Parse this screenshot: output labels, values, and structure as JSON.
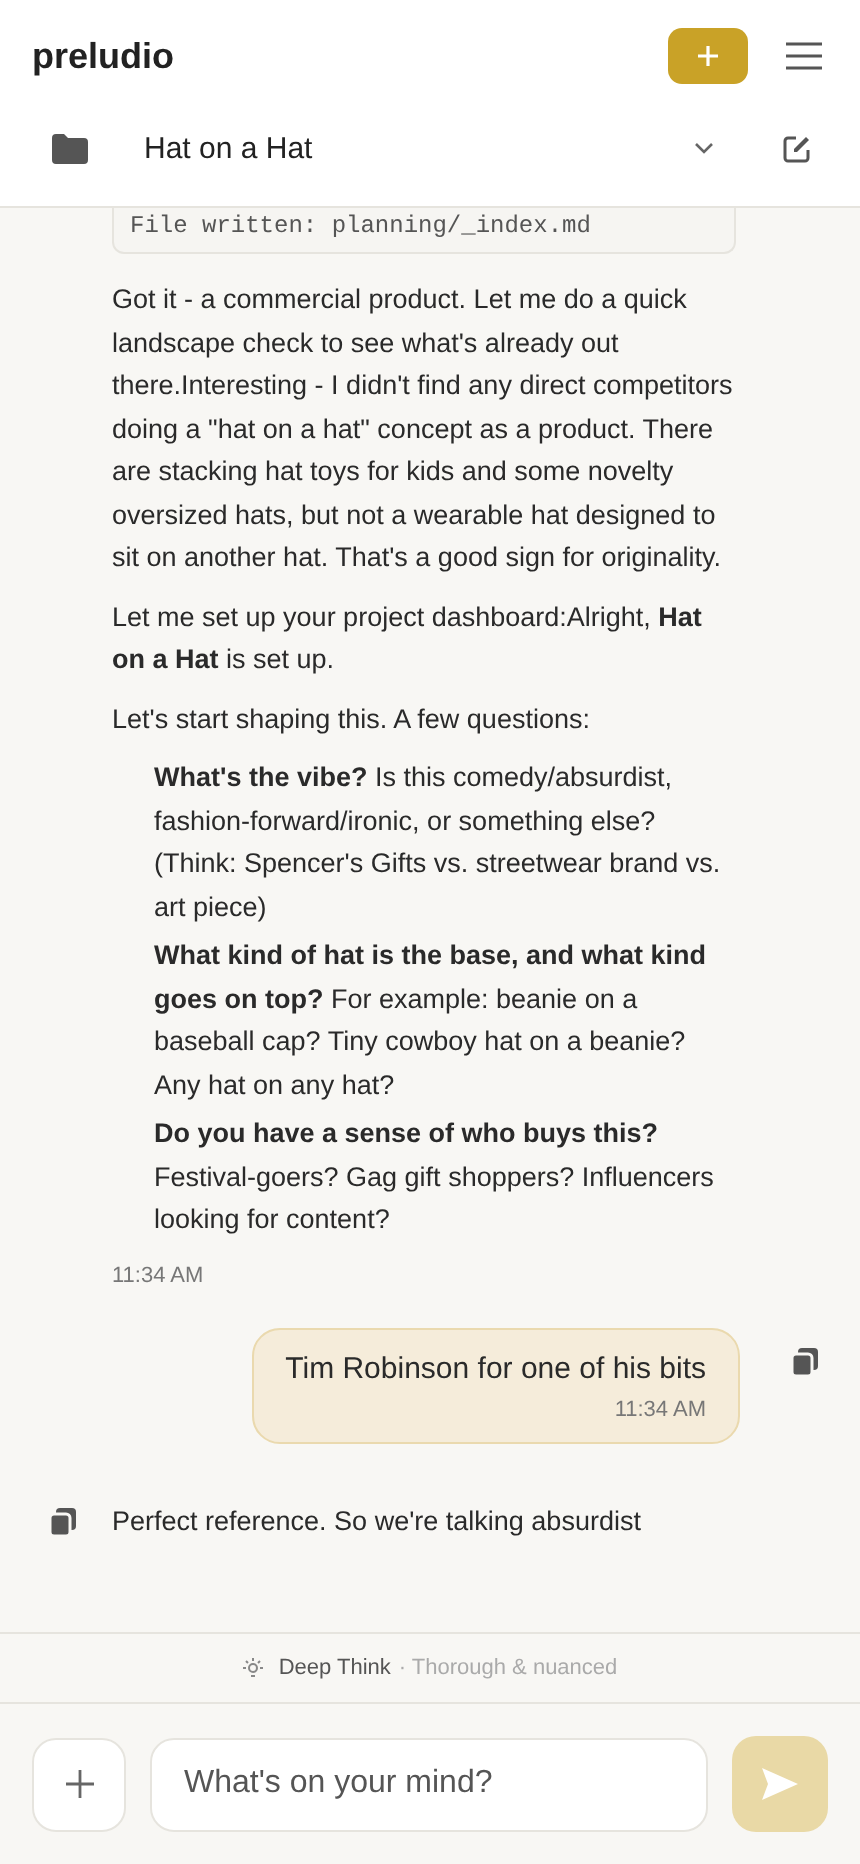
{
  "header": {
    "brand": "preludio"
  },
  "project": {
    "title": "Hat on a Hat"
  },
  "messages": [
    {
      "kind": "assistant",
      "copy_icon": false,
      "time": "11:34 AM",
      "blocks": [
        {
          "kind": "code",
          "text": "File written: planning/_index.md"
        },
        {
          "kind": "paragraph",
          "text": "Got it - a commercial product. Let me do a quick landscape check to see what's already out there.Interesting - I didn't find any direct competitors doing a \"hat on a hat\" concept as a product. There are stacking hat toys for kids and some novelty oversized hats, but not a wearable hat designed to sit on another hat. That's a good sign for originality."
        },
        {
          "kind": "paragraph",
          "text": "Let me set up your project dashboard:Alright, **Hat on a Hat** is set up."
        },
        {
          "kind": "paragraph",
          "text": "Let's start shaping this. A few questions:"
        },
        {
          "kind": "list",
          "items": [
            "**What's the vibe?** Is this comedy/absurdist, fashion-forward/ironic, or something else? (Think: Spencer's Gifts vs. streetwear brand vs. art piece)",
            "**What kind of hat is the base, and what kind goes on top?** For example: beanie on a baseball cap? Tiny cowboy hat on a beanie? Any hat on any hat?",
            "**Do you have a sense of who buys this?** Festival-goers? Gag gift shoppers? Influencers looking for content?"
          ]
        }
      ]
    },
    {
      "kind": "user",
      "copy_icon": true,
      "text": "Tim Robinson for one of his bits",
      "time": "11:34 AM"
    },
    {
      "kind": "assistant",
      "copy_icon": true,
      "blocks": [
        {
          "kind": "paragraph",
          "text": "Perfect reference. So we're talking absurdist"
        }
      ]
    }
  ],
  "mode": {
    "label": "Deep Think",
    "hint": "· Thorough & nuanced"
  },
  "composer": {
    "placeholder": "What's on your mind?",
    "send_disabled": true
  }
}
